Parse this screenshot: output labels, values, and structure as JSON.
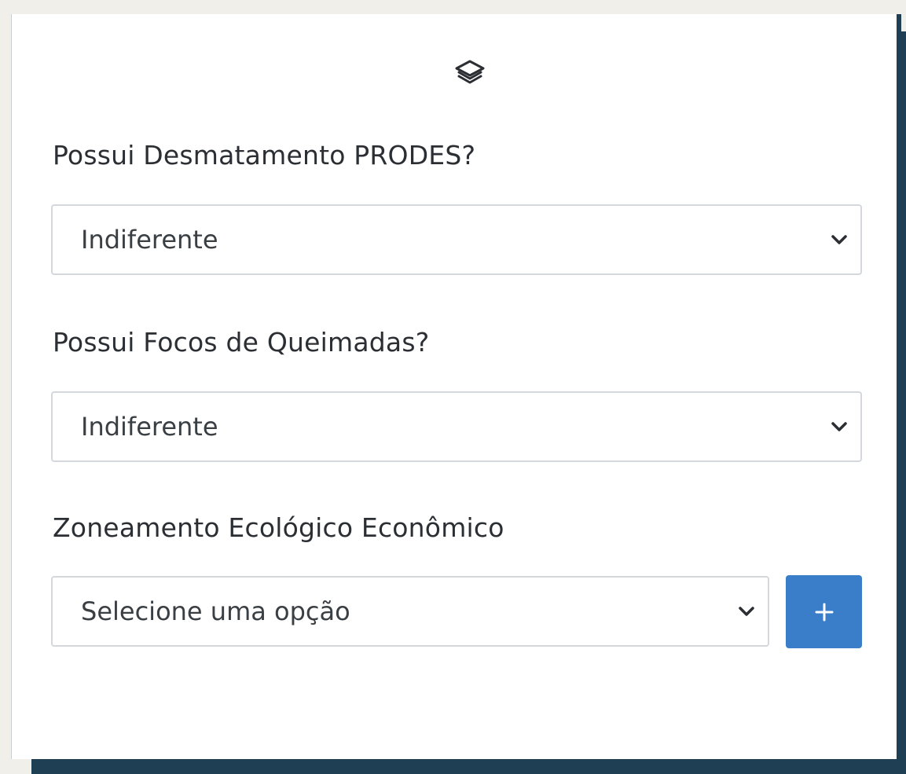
{
  "toolbar": {
    "icon": "layers-icon"
  },
  "fields": [
    {
      "label": "Possui Desmatamento PRODES?",
      "value": "Indiferente"
    },
    {
      "label": "Possui Focos de Queimadas?",
      "value": "Indiferente"
    },
    {
      "label": "Zoneamento Ecológico Econômico",
      "value": "Selecione uma opção"
    }
  ],
  "add_button": {
    "label": "+",
    "color": "#3a7dc9"
  },
  "colors": {
    "panel_background": "#ffffff",
    "frame": "#1f3f55",
    "page_background": "#f0efea"
  }
}
